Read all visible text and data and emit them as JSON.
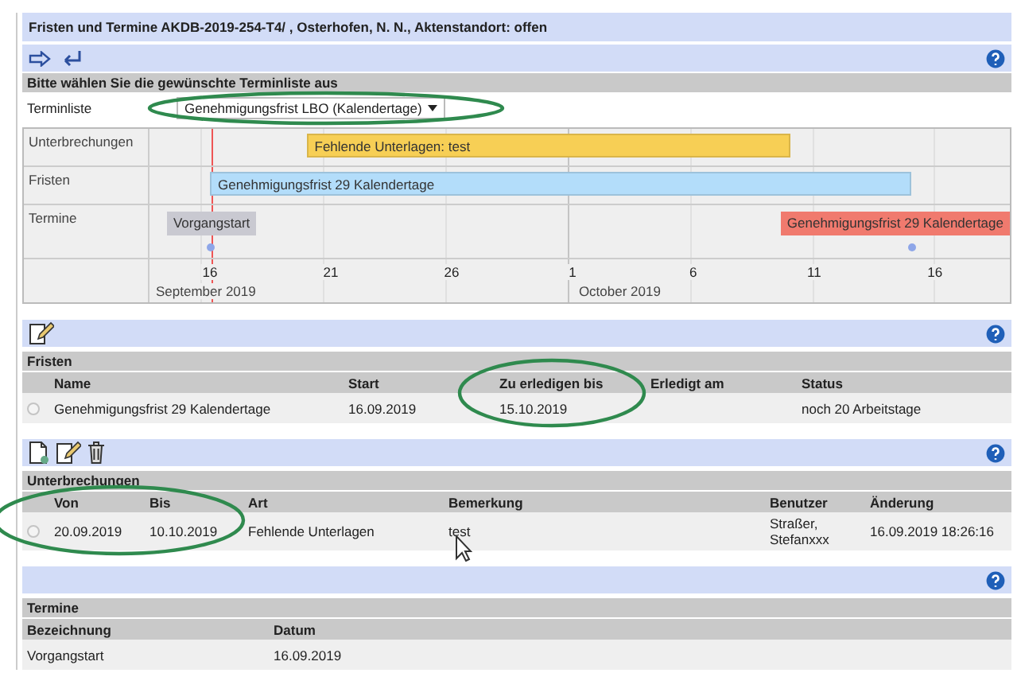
{
  "window": {
    "title": "Fristen und Termine AKDB-2019-254-T4/ , Osterhofen, N. N., Aktenstandort: offen"
  },
  "terminliste": {
    "heading": "Bitte wählen Sie die gewünschte Terminliste aus",
    "label": "Terminliste",
    "value": "Genehmigungsfrist LBO (Kalendertage)"
  },
  "timeline": {
    "rows": [
      {
        "label": "Unterbrechungen",
        "items": [
          {
            "kind": "bar",
            "text": "Fehlende Unterlagen: test",
            "color": "#f7cf55"
          }
        ]
      },
      {
        "label": "Fristen",
        "items": [
          {
            "kind": "bar",
            "text": "Genehmigungsfrist 29 Kalendertage",
            "color": "#b3ddfa"
          }
        ]
      },
      {
        "label": "Termine",
        "items": [
          {
            "kind": "point",
            "text": "Vorgangstart",
            "color": "#c9c9d1"
          },
          {
            "kind": "point",
            "text": "Genehmigungsfrist 29 Kalendertage",
            "color": "#f07a6e"
          }
        ]
      }
    ],
    "ticks": [
      "16",
      "21",
      "26",
      "1",
      "6",
      "11",
      "16"
    ],
    "months": [
      "September 2019",
      "October 2019"
    ]
  },
  "sections": [
    {
      "title": "Fristen",
      "columns": [
        "Name",
        "Start",
        "Zu erledigen bis",
        "Erledigt am",
        "Status"
      ],
      "rows": [
        {
          "selected": false,
          "cells": [
            "Genehmigungsfrist 29 Kalendertage",
            "16.09.2019",
            "15.10.2019",
            "",
            "noch 20 Arbeitstage"
          ]
        }
      ]
    },
    {
      "title": "Unterbrechungen",
      "columns": [
        "Von",
        "Bis",
        "Art",
        "Bemerkung",
        "Benutzer",
        "Änderung"
      ],
      "rows": [
        {
          "selected": false,
          "cells": [
            "20.09.2019",
            "10.10.2019",
            "Fehlende Unterlagen",
            "test",
            "Straßer, Stefanxxx",
            "16.09.2019 18:26:16"
          ]
        }
      ]
    },
    {
      "title": "Termine",
      "columns": [
        "Bezeichnung",
        "Datum"
      ],
      "rows": [
        {
          "cells": [
            "Vorgangstart",
            "16.09.2019"
          ]
        }
      ]
    }
  ]
}
